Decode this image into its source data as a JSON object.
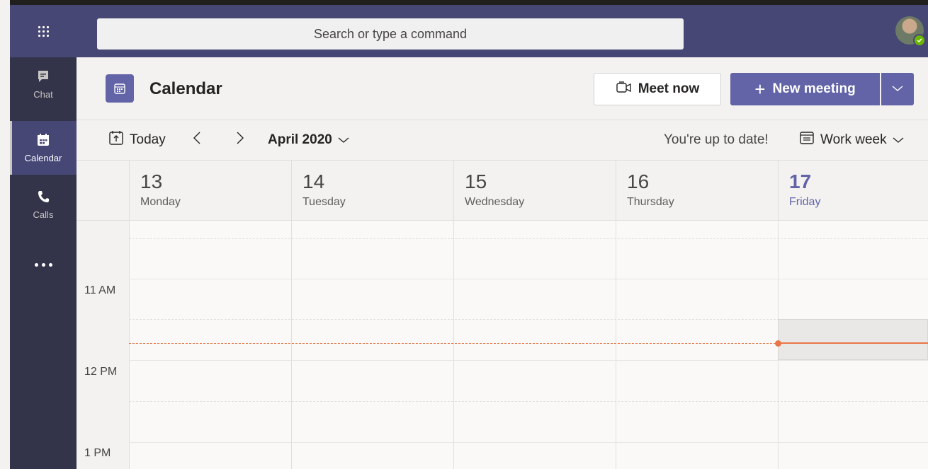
{
  "titlebar": {
    "search_placeholder": "Search or type a command"
  },
  "rail": {
    "items": [
      {
        "label": "Chat",
        "icon": "chat-icon"
      },
      {
        "label": "Calendar",
        "icon": "calendar-icon",
        "active": true
      },
      {
        "label": "Calls",
        "icon": "phone-icon"
      }
    ]
  },
  "header": {
    "title": "Calendar",
    "meet_now": "Meet now",
    "new_meeting": "New meeting"
  },
  "toolbar": {
    "today": "Today",
    "month": "April 2020",
    "status": "You're up to date!",
    "view": "Work week"
  },
  "days": [
    {
      "num": "13",
      "name": "Monday"
    },
    {
      "num": "14",
      "name": "Tuesday"
    },
    {
      "num": "15",
      "name": "Wednesday"
    },
    {
      "num": "16",
      "name": "Thursday"
    },
    {
      "num": "17",
      "name": "Friday",
      "today": true
    }
  ],
  "times": [
    "11 AM",
    "12 PM",
    "1 PM"
  ],
  "colors": {
    "accent": "#6264a7",
    "titlebar": "#464775",
    "rail": "#33344a",
    "now_line": "#e97548",
    "presence": "#6bb700"
  }
}
